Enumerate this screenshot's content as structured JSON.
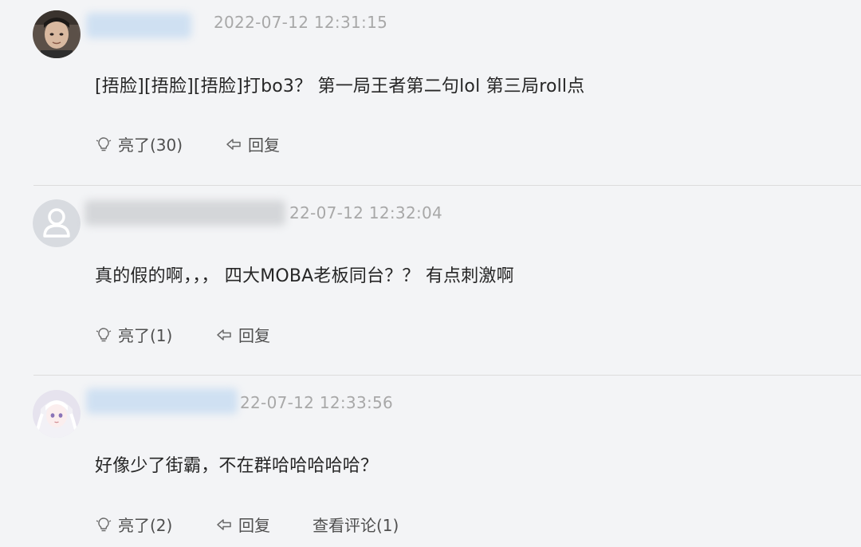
{
  "comments": [
    {
      "timestamp": "2022-07-12 12:31:15",
      "content": "[捂脸][捂脸][捂脸]打bo3？ 第一局王者第二句lol 第三局roll点",
      "like_label": "亮了(30)",
      "reply_label": "回复"
    },
    {
      "timestamp": "22-07-12 12:32:04",
      "content": "真的假的啊，，， 四大MOBA老板同台？？ 有点刺激啊",
      "like_label": "亮了(1)",
      "reply_label": "回复"
    },
    {
      "timestamp": "22-07-12 12:33:56",
      "content": "好像少了街霸，不在群哈哈哈哈哈？",
      "like_label": "亮了(2)",
      "reply_label": "回复",
      "view_comments_label": "查看评论(1)"
    }
  ],
  "icons": {
    "like": "lightbulb-icon",
    "reply": "reply-arrow-icon"
  },
  "colors": {
    "background": "#f3f4f6",
    "text": "#262626",
    "meta": "#a8a8a8",
    "action": "#4f4f4f",
    "username_blur": "#cfe0f2"
  }
}
